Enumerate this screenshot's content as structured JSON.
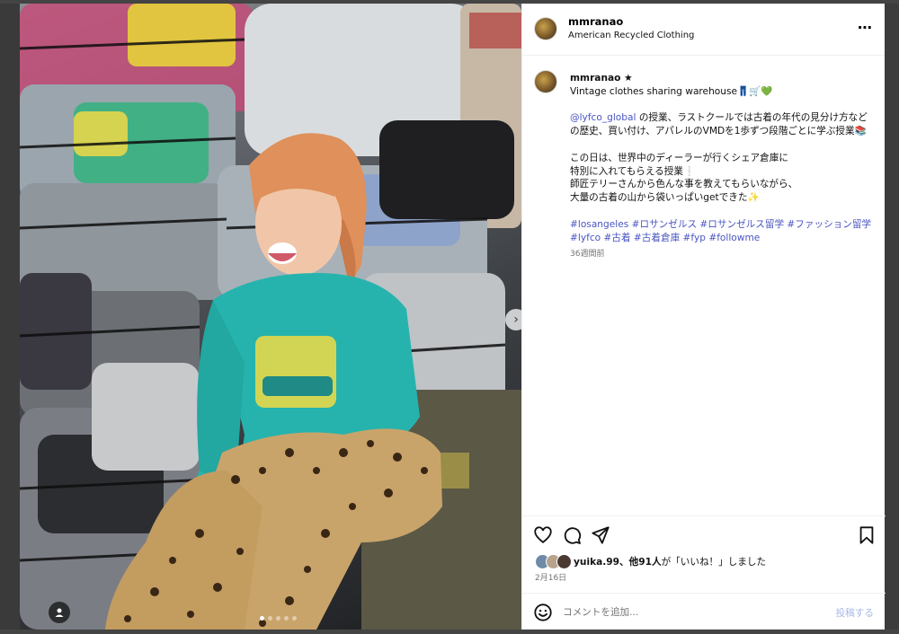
{
  "post": {
    "username": "mmranao",
    "location": "American Recycled Clothing",
    "more_icon": "⋯",
    "caption": {
      "username": "mmranao ★",
      "line1": "Vintage clothes sharing warehouse👖🛒💚",
      "mention": "@lyfco_global",
      "line2": " の授業、ラストクールでは古着の年代の見分け方などの歴史、買い付け、アパレルのVMDを1歩ずつ段階ごとに学ぶ授業📚",
      "line3": "この日は、世界中のディーラーが行くシェア倉庫に",
      "line4": "特別に入れてもらえる授業❕",
      "line5": "師匠テリーさんから色んな事を教えてもらいながら、",
      "line6": "大量の古着の山から袋いっぱいgetできた✨",
      "hashtags": "#losangeles #ロサンゼルス #ロサンゼルス留学 #ファッション留学 #lyfco #古着 #古着倉庫 #fyp #followme",
      "time": "36週間前"
    },
    "likes": {
      "prefix_user": "yuika.99",
      "text": "、他91人",
      "suffix": "が「いいね！」しました"
    },
    "date": "2月16日",
    "comment": {
      "placeholder": "コメントを追加...",
      "post_label": "投稿する"
    },
    "photo": {
      "next_icon": "›",
      "slide_count": 5,
      "active_slide": 1
    }
  },
  "icons": {
    "like": "heart-icon",
    "comment": "comment-icon",
    "share": "send-icon",
    "save": "bookmark-icon",
    "emoji": "smiley-icon",
    "more": "more-horizontal-icon"
  },
  "colors": {
    "link": "#4a55c2",
    "muted": "#737373",
    "post_button": "#a9b9e6"
  }
}
